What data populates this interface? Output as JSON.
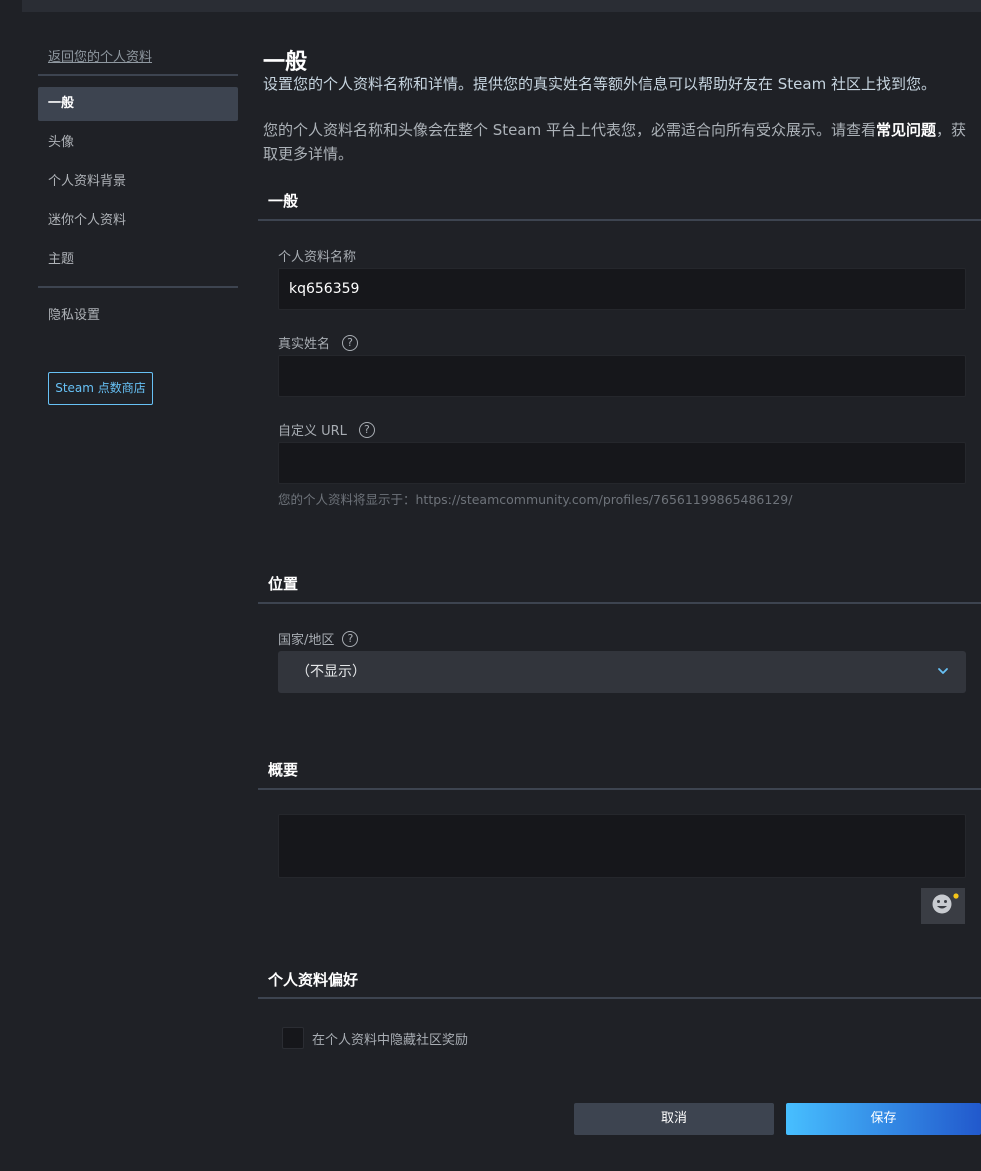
{
  "sidebar": {
    "back_link": "返回您的个人资料",
    "items": [
      "一般",
      "头像",
      "个人资料背景",
      "迷你个人资料",
      "主题"
    ],
    "privacy": "隐私设置",
    "points_shop": "Steam 点数商店"
  },
  "page": {
    "title": "一般",
    "intro": "设置您的个人资料名称和详情。提供您的真实姓名等额外信息可以帮助好友在 Steam 社区上找到您。",
    "intro2_prefix": "您的个人资料名称和头像会在整个 Steam 平台上代表您，必需适合向所有受众展示。请查看",
    "intro2_link": "常见问题",
    "intro2_suffix": "，获取更多详情。"
  },
  "general": {
    "section_title": "一般",
    "profile_name_label": "个人资料名称",
    "profile_name_value": "kq656359",
    "real_name_label": "真实姓名",
    "real_name_value": "",
    "custom_url_label": "自定义 URL",
    "custom_url_value": "",
    "url_hint": "您的个人资料将显示于：https://steamcommunity.com/profiles/76561199865486129/"
  },
  "location": {
    "section_title": "位置",
    "country_label": "国家/地区",
    "country_value": "（不显示）"
  },
  "summary": {
    "section_title": "概要"
  },
  "preferences": {
    "section_title": "个人资料偏好",
    "hide_awards_label": "在个人资料中隐藏社区奖励"
  },
  "actions": {
    "cancel": "取消",
    "save": "保存"
  },
  "icons": {
    "help": "?",
    "chevron": "chevron-down-icon",
    "emoji": "emoticon-icon"
  },
  "colors": {
    "accent": "#67c1f5",
    "background": "#1f2126",
    "nav_active": "#3d4450",
    "save_start": "#47bfff",
    "save_end": "#1a44c2"
  }
}
